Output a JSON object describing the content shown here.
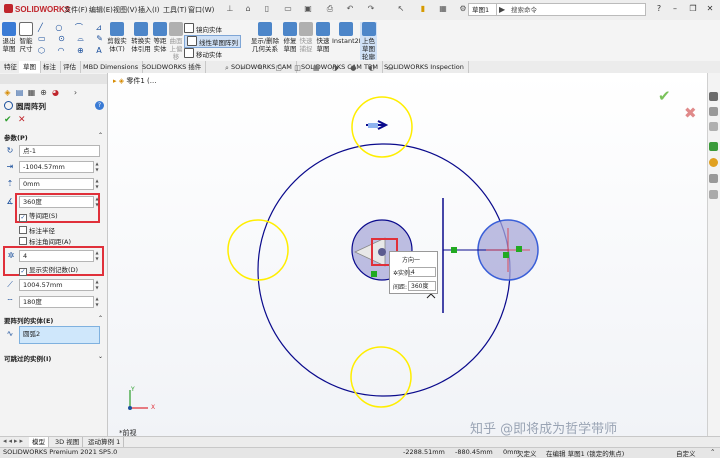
{
  "app": {
    "logo": "SOLIDWORKS",
    "menu": [
      "文件(F)",
      "编辑(E)",
      "视图(V)",
      "插入(I)",
      "工具(T)",
      "窗口(W)"
    ],
    "document_tab": "草图1",
    "search_placeholder": "搜索命令"
  },
  "command_manager": {
    "big_buttons": [
      {
        "label": "退出草图",
        "color": "#3a7bd5"
      },
      {
        "label": "智能尺寸",
        "color": "#6b6b6b"
      }
    ],
    "sketch_row1": [
      "╱",
      "○",
      "⌒",
      "▭",
      "◇",
      "✎",
      "A"
    ],
    "mid_buttons": [
      {
        "label": "剪裁实体(T)",
        "color": "#4d86c9"
      },
      {
        "label": "转换实体引用",
        "color": "#4d86c9"
      },
      {
        "label": "等距实体",
        "color": "#4d86c9"
      },
      {
        "label": "曲面上偏移",
        "color": "#b0b0b0"
      }
    ],
    "mirror_label": "镜向实体",
    "linear_pattern_label": "线性草图阵列",
    "move_label": "移动实体",
    "right_buttons": [
      {
        "label": "显示/删除几何关系",
        "color": "#4d86c9"
      },
      {
        "label": "修复草图",
        "color": "#4d86c9"
      },
      {
        "label": "快速捕捉",
        "color": "#b0b0b0"
      },
      {
        "label": "快速草图",
        "color": "#4d86c9"
      },
      {
        "label": "Instant2D",
        "color": "#4d86c9"
      },
      {
        "label": "上色草图轮廓",
        "color": "#4d86c9"
      }
    ]
  },
  "tabs": [
    "特征",
    "草图",
    "标注",
    "评估",
    "MBD Dimensions",
    "SOLIDWORKS 插件",
    "SOLIDWORKS CAM",
    "SOLIDWORKS CAM TBM",
    "SOLIDWORKS Inspection"
  ],
  "active_tab_index": 1,
  "breadcrumb": "零件1 (...",
  "property_manager": {
    "title": "圆周阵列",
    "help": "?",
    "ok": "✔",
    "cancel": "✕",
    "params_section": "参数(P)",
    "center_point": "点-1",
    "center_x": "-1004.57mm",
    "center_y": "0mm",
    "angle": "360度",
    "equal_spacing_label": "等间距(S)",
    "equal_spacing_checked": true,
    "dim_radius_label": "标注半径",
    "dim_radius_checked": false,
    "dim_angle_label": "标注角间距(A)",
    "dim_angle_checked": false,
    "instances": "4",
    "show_count_label": "显示实例记数(D)",
    "show_count_checked": true,
    "radius": "1004.57mm",
    "arc_angle": "180度",
    "entities_section": "要阵列的实体(E)",
    "entity": "圆弧2",
    "skip_section": "可跳过的实例(I)"
  },
  "popup": {
    "title": "方向一",
    "instances_label": "实例:",
    "instances_value": "4",
    "spacing_label": "间距:",
    "spacing_value": "360度"
  },
  "view_label": "*前视",
  "bottom_tabs": [
    "模型",
    "3D 视图",
    "运动算例 1"
  ],
  "status": {
    "product": "SOLIDWORKS Premium 2021 SP5.0",
    "x": "-2288.51mm",
    "y": "-880.45mm",
    "z": "0mm",
    "defined": "欠定义",
    "editing": "在编辑 草图1 (锁定的焦点)",
    "units": "自定义"
  },
  "watermark": "知乎 @即将成为哲学带师",
  "colors": {
    "accent_blue": "#1a4f9c",
    "highlight_red": "#e0303a",
    "pattern_yellow": "#ffee00",
    "sketch_blue": "#0a0a8c",
    "confirm_green": "#7ac25a"
  }
}
